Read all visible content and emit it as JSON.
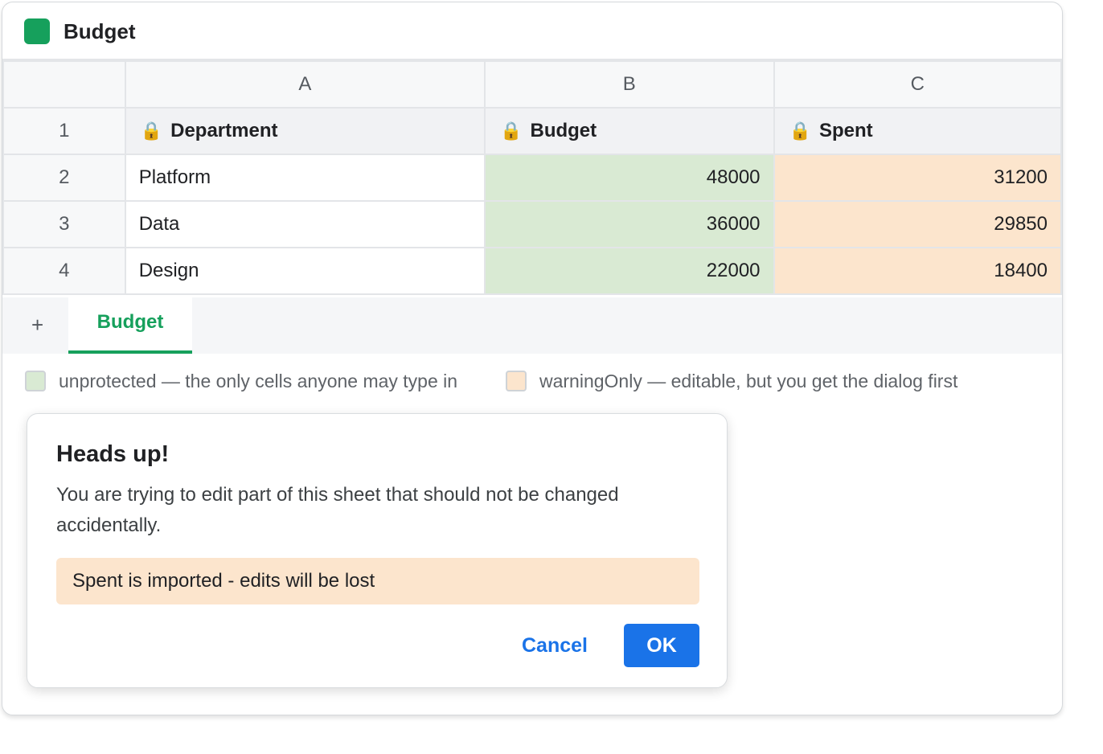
{
  "app": {
    "title": "Budget",
    "icon": "sheet-icon",
    "accent_color": "#16a05c"
  },
  "grid": {
    "column_headers": [
      "A",
      "B",
      "C"
    ],
    "row_numbers": [
      "1",
      "2",
      "3",
      "4"
    ],
    "header_row": {
      "lock_icon": "🔒",
      "cells": [
        "Department",
        "Budget",
        "Spent"
      ]
    },
    "rows": [
      {
        "department": "Platform",
        "budget": "48000",
        "spent": "31200"
      },
      {
        "department": "Data",
        "budget": "36000",
        "spent": "29850"
      },
      {
        "department": "Design",
        "budget": "22000",
        "spent": "18400"
      }
    ],
    "colors": {
      "unprotected": "#d9ead3",
      "warning_only": "#fce5cd"
    }
  },
  "tabs": {
    "add_label": "+",
    "active_label": "Budget"
  },
  "legend": {
    "unprotected_label": "unprotected — the only cells anyone may type in",
    "warning_label": "warningOnly — editable, but you get the dialog first"
  },
  "dialog": {
    "title": "Heads up!",
    "message": "You are trying to edit part of this sheet that should not be changed accidentally.",
    "note": "Spent is imported - edits will be lost",
    "cancel_label": "Cancel",
    "ok_label": "OK",
    "ok_color": "#1a73e8"
  }
}
